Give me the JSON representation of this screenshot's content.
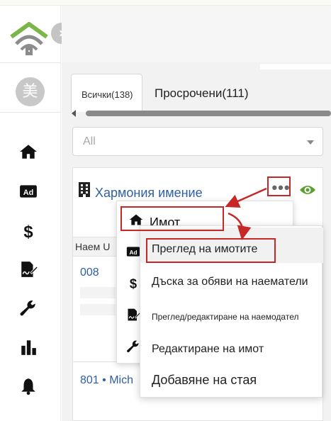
{
  "sidebar": {
    "avatar_initial": "美",
    "collapse_glyph": "›",
    "icons": [
      "home-icon",
      "ad-icon",
      "dollar-icon",
      "lease-sign-icon",
      "wrench-icon",
      "bar-chart-icon",
      "bell-icon"
    ]
  },
  "tabs": [
    {
      "label": "Всички(138)"
    },
    {
      "label": "Просрочени(111)"
    }
  ],
  "filter": {
    "selected": "All"
  },
  "property": {
    "name": "Хармония имение",
    "more_label": "•••"
  },
  "table": {
    "header": "Наем U"
  },
  "rows": [
    {
      "unit": "008"
    },
    {
      "unit": "801 • Mich"
    }
  ],
  "menu_primary": {
    "title": "Имот",
    "side_icons": [
      "ad-icon",
      "dollar-icon",
      "lease-sign-icon",
      "wrench-icon"
    ]
  },
  "menu_property": {
    "items": [
      {
        "label": "Преглед на имотите"
      },
      {
        "label": "Дъска за обяви на наематели"
      },
      {
        "label": "Преглед/редактиране на наемодател"
      },
      {
        "label": "Редактиране на имот"
      },
      {
        "label": "Добавяне на стая"
      }
    ]
  },
  "colors": {
    "link": "#2f5fa0",
    "annotation": "#c62828",
    "logo": "#7ab648",
    "eye": "#5a9e32"
  }
}
